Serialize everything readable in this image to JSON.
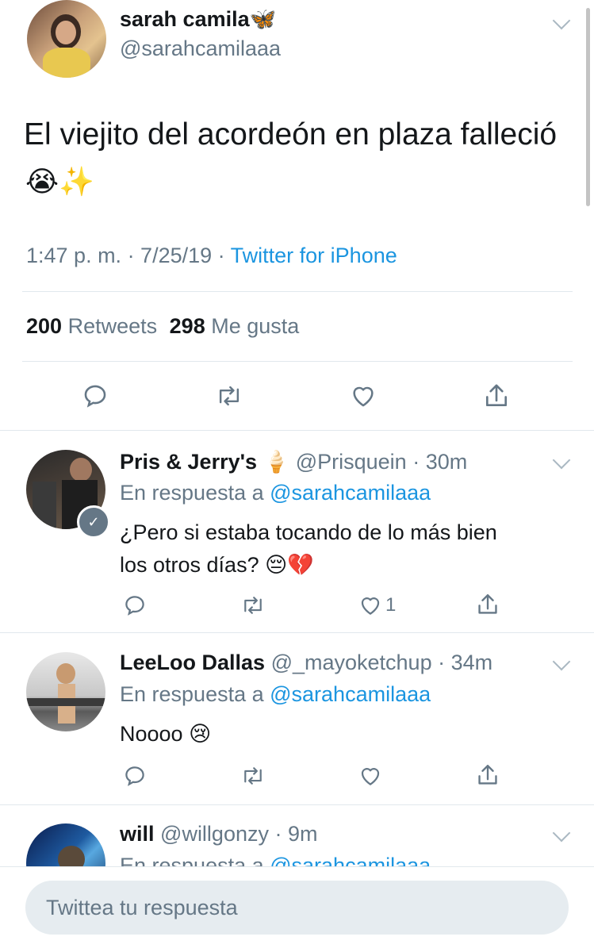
{
  "main_tweet": {
    "display_name": "sarah camila",
    "name_emoji": "🦋",
    "handle": "@sarahcamilaaa",
    "text": "El viejito del acordeón en plaza falleció",
    "text_emoji": "😭✨",
    "timestamp": "1:47 p. m. · 7/25/19 · ",
    "source": "Twitter for iPhone",
    "retweets_count": "200",
    "retweets_label": "Retweets",
    "likes_count": "298",
    "likes_label": "Me gusta"
  },
  "replies": [
    {
      "display_name": "Pris & Jerry's",
      "name_emoji": "🍦",
      "handle": "@Prisquein",
      "time": "· 30m",
      "reply_prefix": "En respuesta a ",
      "reply_to": "@sarahcamilaaa",
      "text_line1": "¿Pero si estaba tocando de lo más bien",
      "text_line2": "los otros días?",
      "text_emoji": "😔💔",
      "like_count": "1"
    },
    {
      "display_name": "LeeLoo Dallas",
      "handle": "@_mayoketchup",
      "time": "· 34m",
      "reply_prefix": "En respuesta a ",
      "reply_to": "@sarahcamilaaa",
      "text": "Noooo",
      "text_emoji": "😢",
      "like_count": ""
    },
    {
      "display_name": "will",
      "handle": "@willgonzy",
      "time": "· 9m",
      "reply_prefix": "En respuesta a ",
      "reply_to": "@sarahcamilaaa"
    }
  ],
  "composer": {
    "placeholder": "Twittea tu respuesta"
  },
  "colors": {
    "link": "#1b95e0",
    "muted": "#657786",
    "divider": "#e1e8ed",
    "composer_bg": "#e6ecf0"
  },
  "icons": [
    "reply-icon",
    "retweet-icon",
    "like-icon",
    "share-icon",
    "chevron-down-icon"
  ]
}
